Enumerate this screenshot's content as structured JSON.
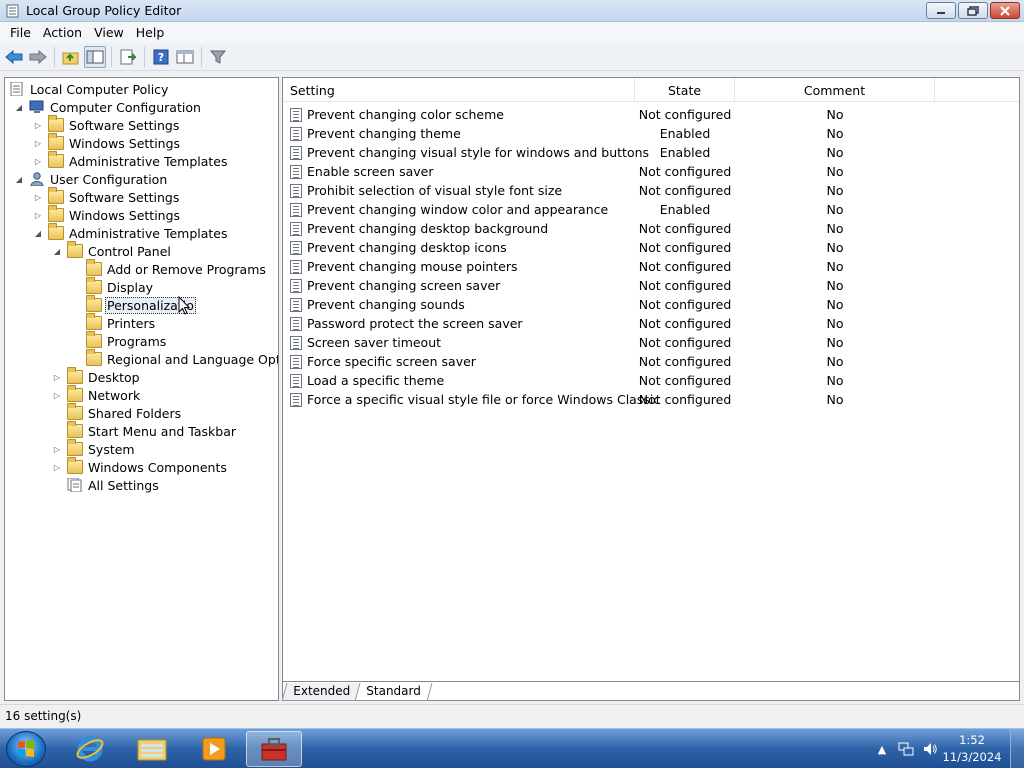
{
  "window": {
    "title": "Local Group Policy Editor"
  },
  "menu": [
    {
      "label": "File"
    },
    {
      "label": "Action"
    },
    {
      "label": "View"
    },
    {
      "label": "Help"
    }
  ],
  "toolbar": {
    "buttons": [
      "back-icon",
      "forward-icon",
      "up-folder-icon",
      "show-hide-tree-icon",
      "export-list-icon",
      "help-icon",
      "properties-icon",
      "filter-icon"
    ]
  },
  "tree": {
    "root": "Local Computer Policy",
    "computer_config": "Computer Configuration",
    "cc_software": "Software Settings",
    "cc_windows": "Windows Settings",
    "cc_admin": "Administrative Templates",
    "user_config": "User Configuration",
    "uc_software": "Software Settings",
    "uc_windows": "Windows Settings",
    "uc_admin": "Administrative Templates",
    "control_panel": "Control Panel",
    "add_remove": "Add or Remove Programs",
    "display": "Display",
    "personalization": "Personalizatio",
    "printers": "Printers",
    "programs": "Programs",
    "regional": "Regional and Language Options",
    "desktop": "Desktop",
    "network": "Network",
    "shared_folders": "Shared Folders",
    "start_menu": "Start Menu and Taskbar",
    "system": "System",
    "windows_components": "Windows Components",
    "all_settings": "All Settings"
  },
  "list": {
    "columns": {
      "setting": "Setting",
      "state": "State",
      "comment": "Comment"
    },
    "rows": [
      {
        "setting": "Prevent changing color scheme",
        "state": "Not configured",
        "comment": "No"
      },
      {
        "setting": "Prevent changing theme",
        "state": "Enabled",
        "comment": "No"
      },
      {
        "setting": "Prevent changing visual style for windows and buttons",
        "state": "Enabled",
        "comment": "No"
      },
      {
        "setting": "Enable screen saver",
        "state": "Not configured",
        "comment": "No"
      },
      {
        "setting": "Prohibit selection of visual style font size",
        "state": "Not configured",
        "comment": "No"
      },
      {
        "setting": "Prevent changing window color and appearance",
        "state": "Enabled",
        "comment": "No"
      },
      {
        "setting": "Prevent changing desktop background",
        "state": "Not configured",
        "comment": "No"
      },
      {
        "setting": "Prevent changing desktop icons",
        "state": "Not configured",
        "comment": "No"
      },
      {
        "setting": "Prevent changing mouse pointers",
        "state": "Not configured",
        "comment": "No"
      },
      {
        "setting": "Prevent changing screen saver",
        "state": "Not configured",
        "comment": "No"
      },
      {
        "setting": "Prevent changing sounds",
        "state": "Not configured",
        "comment": "No"
      },
      {
        "setting": "Password protect the screen saver",
        "state": "Not configured",
        "comment": "No"
      },
      {
        "setting": "Screen saver timeout",
        "state": "Not configured",
        "comment": "No"
      },
      {
        "setting": "Force specific screen saver",
        "state": "Not configured",
        "comment": "No"
      },
      {
        "setting": "Load a specific theme",
        "state": "Not configured",
        "comment": "No"
      },
      {
        "setting": "Force a specific visual style file or force Windows Classic",
        "state": "Not configured",
        "comment": "No"
      }
    ]
  },
  "tabs": {
    "extended": "Extended",
    "standard": "Standard"
  },
  "status": {
    "text": "16 setting(s)"
  },
  "taskbar": {
    "time": "1:52",
    "date": "11/3/2024"
  }
}
